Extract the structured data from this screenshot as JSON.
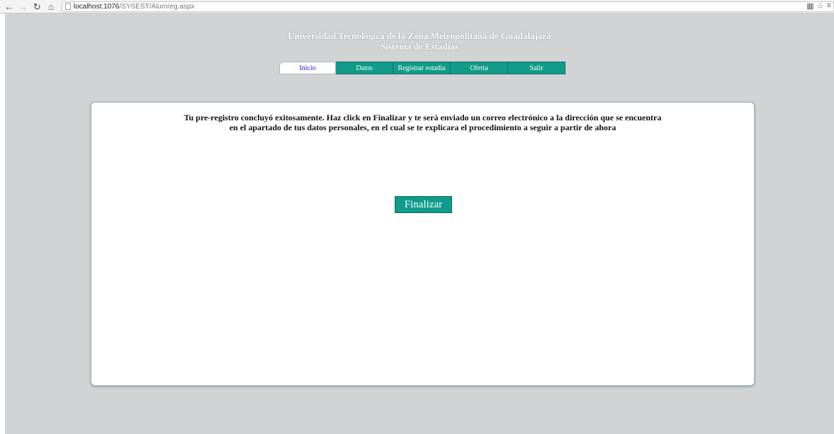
{
  "browser": {
    "url_host": "localhost:1076",
    "url_path": "/SYSEST/Alumreg.aspx"
  },
  "header": {
    "title_line1": "Universidad Tecnologica de la Zona Metropolitana de Guadalajara",
    "title_line2": "Sistema de Estadias"
  },
  "tabs": [
    {
      "label": "Inicio"
    },
    {
      "label": "Datos"
    },
    {
      "label": "Registrar estadia"
    },
    {
      "label": "Oferta"
    },
    {
      "label": "Salir"
    }
  ],
  "main": {
    "message_line1": "Tu pre-registro concluyó exitosamente. Haz click en Finalizar y te será enviado un correo electrónico a la dirección que se encuentra",
    "message_line2": "en el apartado de tus datos personales, en el cual se te explicara el procedimiento a seguir a partir de ahora",
    "finalizar_label": "Finalizar"
  },
  "colors": {
    "accent": "#109b8a",
    "page_bg": "#d1d3d5",
    "active_tab_text": "#1a1ab4"
  }
}
